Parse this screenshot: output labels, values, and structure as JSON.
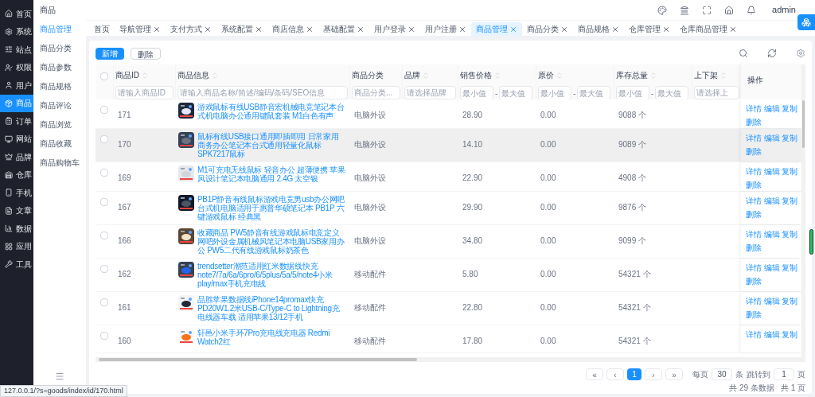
{
  "nav": [
    {
      "label": "首页",
      "selected": false
    },
    {
      "label": "系统",
      "selected": false
    },
    {
      "label": "站点",
      "selected": false
    },
    {
      "label": "权限",
      "selected": false
    },
    {
      "label": "用户",
      "selected": false
    },
    {
      "label": "商品",
      "selected": true
    },
    {
      "label": "订单",
      "selected": false
    },
    {
      "label": "网站",
      "selected": false
    },
    {
      "label": "品牌",
      "selected": false
    },
    {
      "label": "仓库",
      "selected": false
    },
    {
      "label": "手机",
      "selected": false
    },
    {
      "label": "文章",
      "selected": false
    },
    {
      "label": "数据",
      "selected": false
    },
    {
      "label": "应用",
      "selected": false
    },
    {
      "label": "工具",
      "selected": false
    }
  ],
  "submenu": {
    "title": "商品",
    "items": [
      {
        "label": "商品管理",
        "selected": true
      },
      {
        "label": "商品分类",
        "selected": false
      },
      {
        "label": "商品参数",
        "selected": false
      },
      {
        "label": "商品规格",
        "selected": false
      },
      {
        "label": "商品评论",
        "selected": false
      },
      {
        "label": "商品浏览",
        "selected": false
      },
      {
        "label": "商品收藏",
        "selected": false
      },
      {
        "label": "商品购物车",
        "selected": false
      }
    ]
  },
  "user": "admin",
  "tabs": [
    {
      "label": "首页",
      "closable": false,
      "selected": false
    },
    {
      "label": "导航管理",
      "closable": true,
      "selected": false
    },
    {
      "label": "支付方式",
      "closable": true,
      "selected": false
    },
    {
      "label": "系统配置",
      "closable": true,
      "selected": false
    },
    {
      "label": "商店信息",
      "closable": true,
      "selected": false
    },
    {
      "label": "基础配置",
      "closable": true,
      "selected": false
    },
    {
      "label": "用户登录",
      "closable": true,
      "selected": false
    },
    {
      "label": "用户注册",
      "closable": true,
      "selected": false
    },
    {
      "label": "商品管理",
      "closable": true,
      "selected": true
    },
    {
      "label": "商品分类",
      "closable": true,
      "selected": false
    },
    {
      "label": "商品规格",
      "closable": true,
      "selected": false
    },
    {
      "label": "仓库管理",
      "closable": true,
      "selected": false
    },
    {
      "label": "仓库商品管理",
      "closable": true,
      "selected": false
    }
  ],
  "toolbar": {
    "add": "新增",
    "delete": "删除"
  },
  "select_all": {
    "checked": false
  },
  "columns": [
    {
      "label": "商品ID",
      "sortable": true,
      "filter": {
        "kind": "text",
        "placeholder": "请输入商品ID"
      }
    },
    {
      "label": "商品信息",
      "sortable": true,
      "filter": {
        "kind": "text",
        "placeholder": "请输入商品名称/简述/编码/条码/SEO信息"
      }
    },
    {
      "label": "商品分类",
      "sortable": false,
      "filter": {
        "kind": "text",
        "placeholder": "商品分类..."
      }
    },
    {
      "label": "品牌",
      "sortable": true,
      "filter": {
        "kind": "text",
        "placeholder": "请选择品牌"
      }
    },
    {
      "label": "销售价格",
      "sortable": true,
      "filter": {
        "kind": "range",
        "min": {
          "placeholder": "最小值"
        },
        "separator": "-",
        "max": {
          "placeholder": "最大值"
        }
      }
    },
    {
      "label": "原价",
      "sortable": true,
      "filter": {
        "kind": "range",
        "min": {
          "placeholder": "最小值"
        },
        "separator": "-",
        "max": {
          "placeholder": "最大值"
        }
      }
    },
    {
      "label": "库存总量",
      "sortable": true,
      "filter": {
        "kind": "range",
        "min": {
          "placeholder": "最小值"
        },
        "separator": "-",
        "max": {
          "placeholder": "最大值"
        }
      }
    },
    {
      "label": "上下架",
      "sortable": true,
      "filter": {
        "kind": "text",
        "placeholder": "请选择上"
      }
    },
    {
      "label": "操作"
    }
  ],
  "rows": [
    {
      "id": "171",
      "name": "游戏鼠标有线USB静音宏机械电竞笔记本台式机电脑办公通用键鼠套装 M1白色有声",
      "category": "电脑外设",
      "price": "28.90",
      "original": "0.00",
      "stock": "9088 个",
      "checked": false,
      "hovered": false,
      "actions": [
        "详情",
        "编辑",
        "复制",
        "删除"
      ]
    },
    {
      "id": "170",
      "name": "鼠标有线USB接口通用即插即用 日常家用商务办公笔记本台式通用轻量化鼠标 SPK7217鼠标",
      "category": "电脑外设",
      "price": "14.10",
      "original": "0.00",
      "stock": "9089 个",
      "checked": false,
      "hovered": true,
      "actions": [
        "详情",
        "编辑",
        "复制",
        "删除"
      ]
    },
    {
      "id": "169",
      "name": "M1可充电无线鼠标 轻音办公 超薄便携 苹果风设计笔记本电脑通用 2.4G 太空银",
      "category": "电脑外设",
      "price": "22.90",
      "original": "0.00",
      "stock": "4908 个",
      "checked": false,
      "hovered": false,
      "actions": [
        "详情",
        "编辑",
        "复制",
        "删除"
      ]
    },
    {
      "id": "167",
      "name": "PB1P静音有线鼠标游戏电竞男usb办公网吧台式机电脑适用于惠普华硕笔记本 PB1P 六键游戏鼠标 经典黑",
      "category": "电脑外设",
      "price": "29.90",
      "original": "0.00",
      "stock": "9876 个",
      "checked": false,
      "hovered": false,
      "actions": [
        "详情",
        "编辑",
        "复制",
        "删除"
      ]
    },
    {
      "id": "166",
      "name": "收藏商品 PW5静音有线游戏鼠标电竞定义网吧外设金属机械风笔记本电脑USB家用办公 PW5二代有线游戏鼠标奶茶色",
      "category": "电脑外设",
      "price": "34.80",
      "original": "0.00",
      "stock": "9099 个",
      "checked": false,
      "hovered": false,
      "actions": [
        "详情",
        "编辑",
        "复制",
        "删除"
      ]
    },
    {
      "id": "162",
      "name": "trendsetter潮范适用红米数据线快充note7/7a/6a/6pro/6/5plus/5a/5/note4小米play/max手机充电线",
      "category": "移动配件",
      "price": "5.80",
      "original": "0.00",
      "stock": "54321 个",
      "checked": false,
      "hovered": false,
      "actions": [
        "详情",
        "编辑",
        "复制",
        "删除"
      ]
    },
    {
      "id": "161",
      "name": "品胜苹果数据线iPhone14promax快充PD20W1.2米USB-C/Type-C to Lightning充电线器车载 适用苹果13/12手机",
      "category": "移动配件",
      "price": "22.80",
      "original": "0.00",
      "stock": "54321 个",
      "checked": false,
      "hovered": false,
      "actions": [
        "详情",
        "编辑",
        "复制",
        "删除"
      ]
    },
    {
      "id": "160",
      "name": "轩邑小米手环7Pro充电线充电器 Redmi Watch2红",
      "category": "移动配件",
      "price": "17.80",
      "original": "0.00",
      "stock": "54321 个",
      "checked": false,
      "hovered": false,
      "actions": [
        "详情",
        "编辑",
        "复制"
      ]
    }
  ],
  "pagination": {
    "first": "«",
    "prev": "‹",
    "pages": [
      {
        "label": "1",
        "selected": true
      }
    ],
    "next": "›",
    "last": "»",
    "per_page_label": "每页",
    "per_page": "30",
    "per_page_unit": "条",
    "jump_label": "跳转到",
    "jump_page": "1",
    "jump_unit": "页",
    "total": "共 29 条数据",
    "pages_total": "共 1 页"
  },
  "status_url": "127.0.0.1/?s=goods/index/id/170.html"
}
